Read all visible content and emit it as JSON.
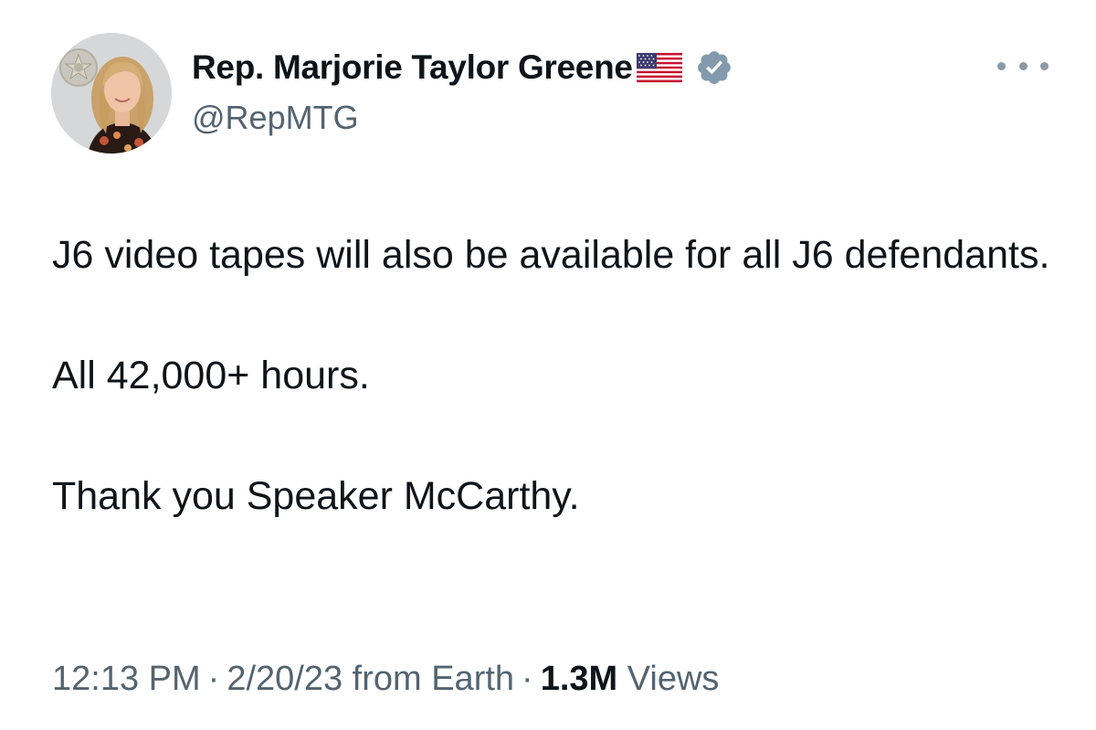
{
  "author": {
    "display_name": "Rep. Marjorie Taylor Greene",
    "handle": "@RepMTG",
    "flag_icon": "us-flag-icon",
    "verified_icon": "verified-badge-icon",
    "verified_color": "#829aab"
  },
  "menu": {
    "icon": "more-options-icon"
  },
  "tweet": {
    "lines": [
      "J6 video tapes will also be available for all J6 defendants.",
      "All 42,000+ hours.",
      "Thank you Speaker McCarthy."
    ]
  },
  "meta": {
    "time": "12:13 PM",
    "separator": "·",
    "date_source": "2/20/23 from Earth",
    "views_count": "1.3M",
    "views_label": "Views"
  }
}
